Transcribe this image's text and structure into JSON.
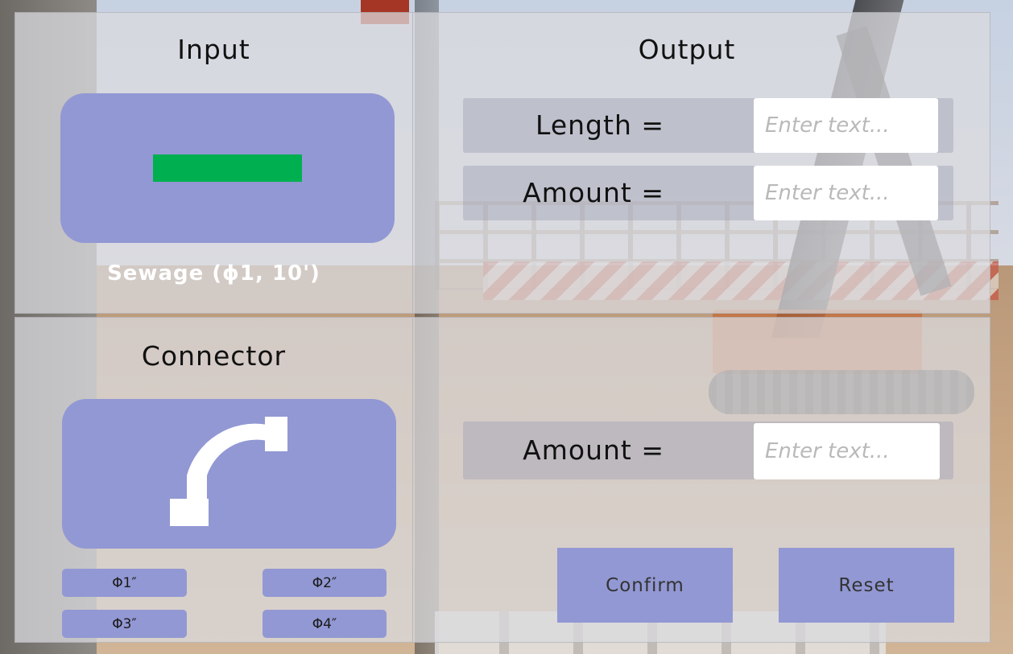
{
  "input": {
    "title": "Input",
    "pipe_label": "Sewage (ϕ1, 10')",
    "pipe_color": "#00b050",
    "pipe_icon": "straight-pipe-icon"
  },
  "output": {
    "title": "Output",
    "length_label": "Length =",
    "length_placeholder": "Enter text...",
    "amount_label": "Amount =",
    "amount_placeholder": "Enter text..."
  },
  "connector": {
    "title": "Connector",
    "icon": "elbow-connector-icon",
    "diameters": [
      "Φ1″",
      "Φ2″",
      "Φ3″",
      "Φ4″"
    ]
  },
  "connector_output": {
    "amount_label": "Amount =",
    "amount_placeholder": "Enter text..."
  },
  "actions": {
    "confirm_label": "Confirm",
    "reset_label": "Reset"
  },
  "colors": {
    "accent": "#9298d3",
    "pipe": "#00b050"
  }
}
